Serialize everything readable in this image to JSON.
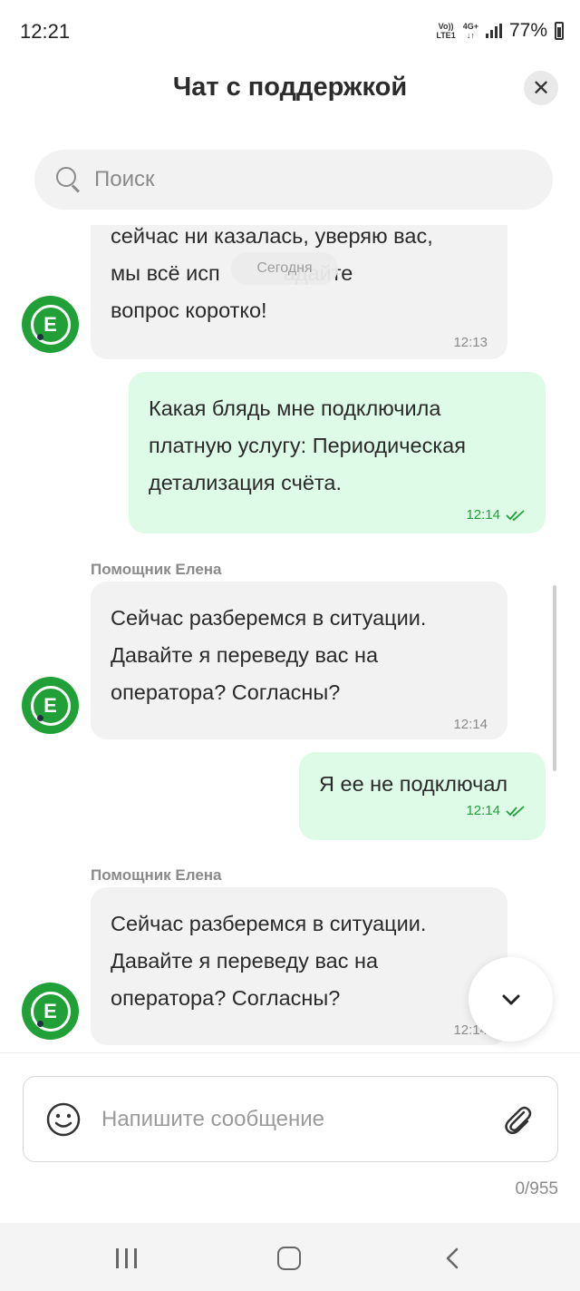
{
  "status_bar": {
    "time": "12:21",
    "volte": "Vo))",
    "lte": "LTE1",
    "network": "4G+",
    "battery": "77%"
  },
  "header": {
    "title": "Чат с поддержкой",
    "close_symbol": "✕"
  },
  "search": {
    "placeholder": "Поиск"
  },
  "chat": {
    "date_separator": "Сегодня",
    "messages": [
      {
        "direction": "incoming",
        "text": "сейчас ни казалась, уверяю вас, мы всё исправим! Задайте вопрос коротко!",
        "line1": "сейчас ни казалась, уверяю вас,",
        "line2": "мы всё исп",
        "line2_tail": "адайте",
        "line3": "вопрос коротко!",
        "time": "12:13"
      },
      {
        "direction": "outgoing",
        "text": "Какая блядь мне подключила платную услугу: Периодическая детализация счёта.",
        "line1": "Какая блядь мне подключила",
        "line2": "платную услугу: Периодическая",
        "line3": "детализация счёта.",
        "time": "12:14",
        "status": "read"
      },
      {
        "direction": "incoming",
        "sender": "Помощник Елена",
        "line1": "Сейчас разберемся в ситуации.",
        "line2": "Давайте я переведу вас на",
        "line3": "оператора? Согласны?",
        "time": "12:14"
      },
      {
        "direction": "outgoing",
        "text": "Я ее не подключал",
        "time": "12:14",
        "status": "read"
      },
      {
        "direction": "incoming",
        "sender": "Помощник Елена",
        "line1": "Сейчас разберемся в ситуации.",
        "line2": "Давайте я переведу вас на",
        "line3": "оператора? Согласны?",
        "time": "12:14"
      }
    ],
    "avatar_letter": "E"
  },
  "composer": {
    "placeholder": "Напишите сообщение",
    "counter": "0/955"
  },
  "colors": {
    "brand_green": "#21a038",
    "outgoing_bubble": "#ddfbe6",
    "incoming_bubble": "#f2f2f2"
  },
  "icons": [
    "search-icon",
    "close-icon",
    "double-check-icon",
    "chevron-down-icon",
    "emoji-icon",
    "paperclip-icon",
    "nav-recent-icon",
    "nav-home-icon",
    "nav-back-icon"
  ]
}
